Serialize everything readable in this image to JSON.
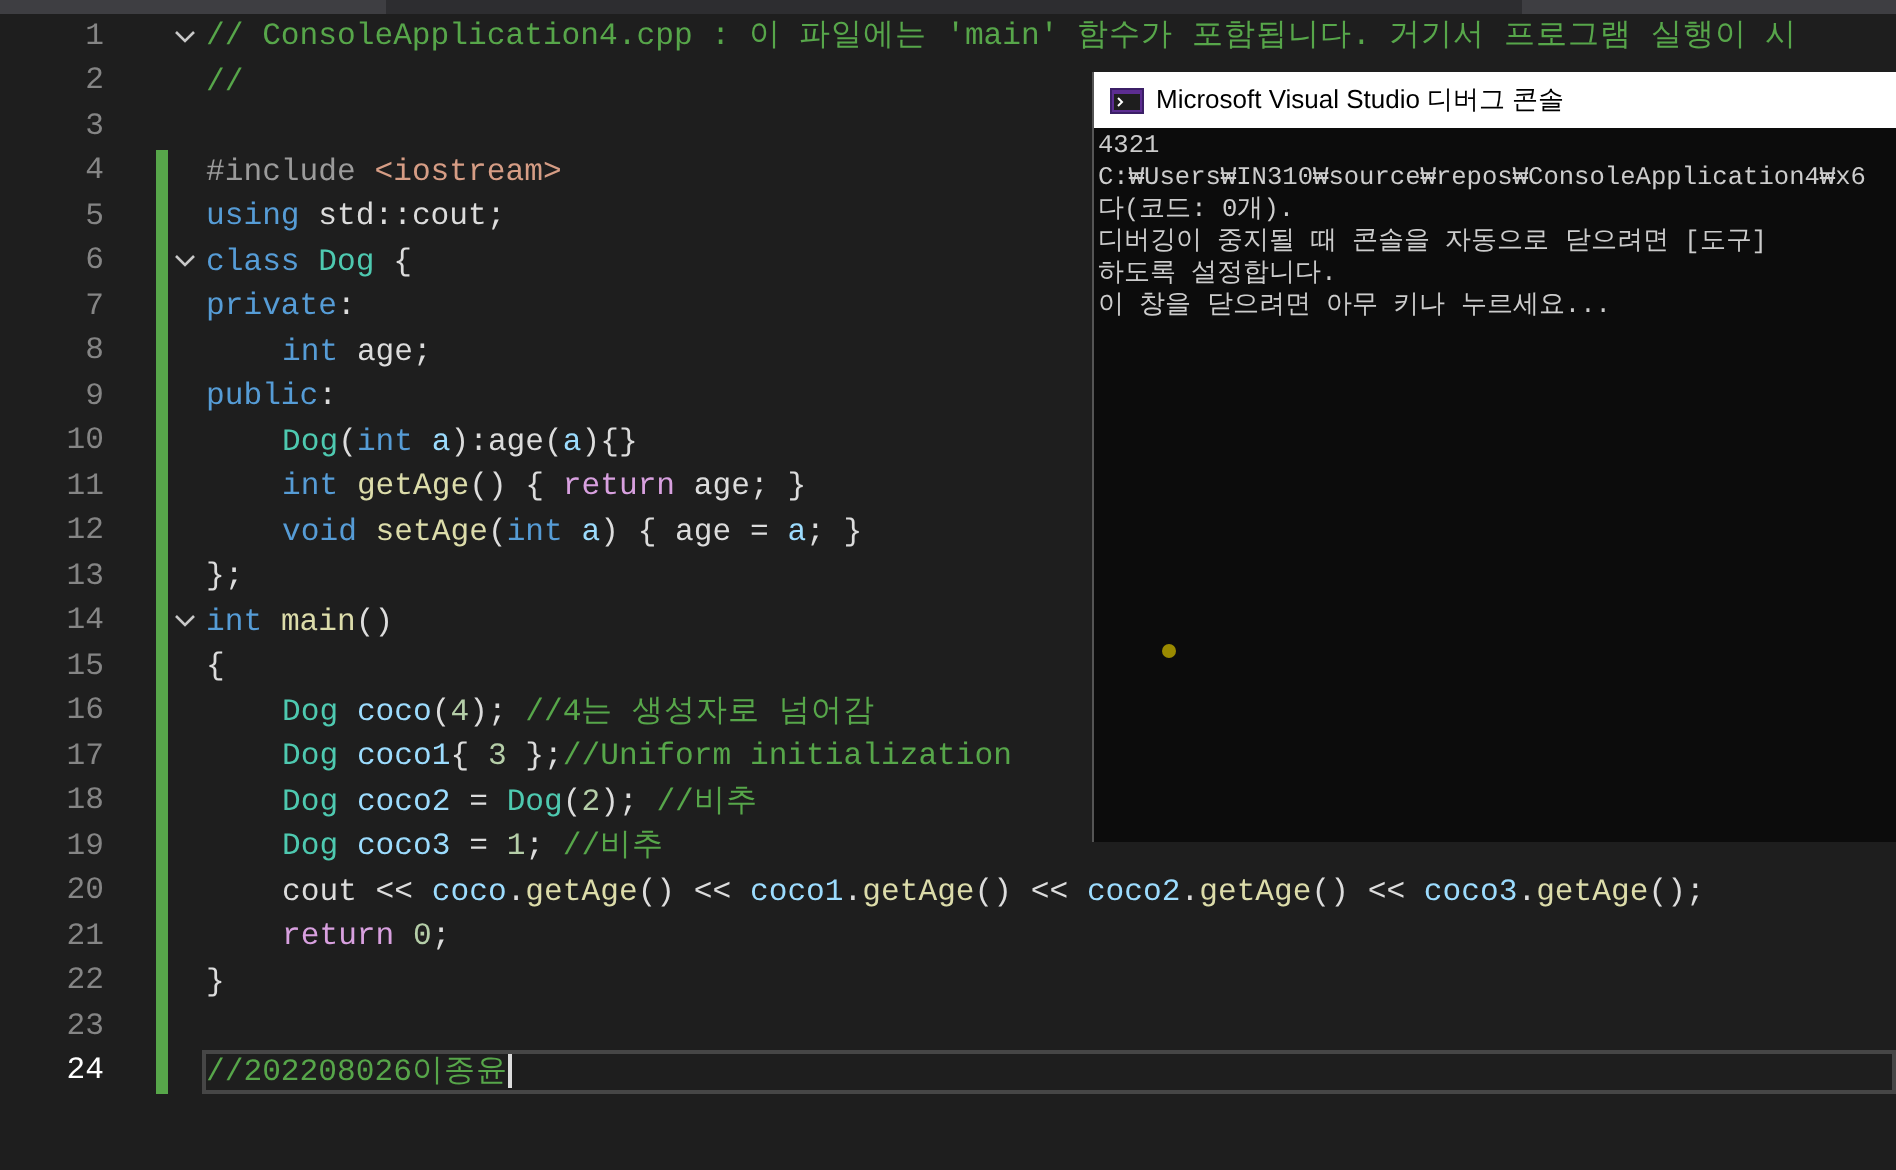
{
  "editor": {
    "lines": [
      {
        "number": "1",
        "fold": true,
        "changed": false,
        "current": false,
        "indented": false,
        "tokens": [
          {
            "kind": "cmt",
            "text": "// ConsoleApplication4.cpp : 이 파일에는 'main' 함수가 포함됩니다. 거기서 프로그램 실행이 시"
          }
        ]
      },
      {
        "number": "2",
        "fold": false,
        "changed": false,
        "current": false,
        "indented": false,
        "tokens": [
          {
            "kind": "cmt",
            "text": "//"
          }
        ]
      },
      {
        "number": "3",
        "fold": false,
        "changed": false,
        "current": false,
        "indented": false
      },
      {
        "number": "4",
        "fold": false,
        "changed": true,
        "current": false,
        "indented": false,
        "tokens": [
          {
            "kind": "pre",
            "text": "#include "
          },
          {
            "kind": "str",
            "text": "<iostream>"
          }
        ]
      },
      {
        "number": "5",
        "fold": false,
        "changed": true,
        "current": false,
        "indented": false,
        "tokens": [
          {
            "kind": "kw",
            "text": "using "
          },
          {
            "kind": "plain",
            "text": "std::cout;"
          }
        ]
      },
      {
        "number": "6",
        "fold": true,
        "changed": true,
        "current": false,
        "indented": false,
        "tokens": [
          {
            "kind": "kw",
            "text": "class "
          },
          {
            "kind": "type",
            "text": "Dog"
          },
          {
            "kind": "plain",
            "text": " {"
          }
        ]
      },
      {
        "number": "7",
        "fold": false,
        "changed": true,
        "current": false,
        "indented": false,
        "tokens": [
          {
            "kind": "kw",
            "text": "private"
          },
          {
            "kind": "plain",
            "text": ":"
          }
        ]
      },
      {
        "number": "8",
        "fold": false,
        "changed": true,
        "current": false,
        "indented": true,
        "tokens": [
          {
            "kind": "kw",
            "text": "int "
          },
          {
            "kind": "plain",
            "text": "age;"
          }
        ]
      },
      {
        "number": "9",
        "fold": false,
        "changed": true,
        "current": false,
        "indented": false,
        "tokens": [
          {
            "kind": "kw",
            "text": "public"
          },
          {
            "kind": "plain",
            "text": ":"
          }
        ]
      },
      {
        "number": "10",
        "fold": false,
        "changed": true,
        "current": false,
        "indented": true,
        "tokens": [
          {
            "kind": "type",
            "text": "Dog"
          },
          {
            "kind": "plain",
            "text": "("
          },
          {
            "kind": "kw",
            "text": "int "
          },
          {
            "kind": "var",
            "text": "a"
          },
          {
            "kind": "plain",
            "text": "):age("
          },
          {
            "kind": "var",
            "text": "a"
          },
          {
            "kind": "plain",
            "text": "){}"
          }
        ]
      },
      {
        "number": "11",
        "fold": false,
        "changed": true,
        "current": false,
        "indented": true,
        "tokens": [
          {
            "kind": "kw",
            "text": "int "
          },
          {
            "kind": "fn",
            "text": "getAge"
          },
          {
            "kind": "plain",
            "text": "() { "
          },
          {
            "kind": "ctl",
            "text": "return"
          },
          {
            "kind": "plain",
            "text": " age; }"
          }
        ]
      },
      {
        "number": "12",
        "fold": false,
        "changed": true,
        "current": false,
        "indented": true,
        "tokens": [
          {
            "kind": "kw",
            "text": "void "
          },
          {
            "kind": "fn",
            "text": "setAge"
          },
          {
            "kind": "plain",
            "text": "("
          },
          {
            "kind": "kw",
            "text": "int "
          },
          {
            "kind": "var",
            "text": "a"
          },
          {
            "kind": "plain",
            "text": ") { age = "
          },
          {
            "kind": "var",
            "text": "a"
          },
          {
            "kind": "plain",
            "text": "; }"
          }
        ]
      },
      {
        "number": "13",
        "fold": false,
        "changed": true,
        "current": false,
        "indented": false,
        "tokens": [
          {
            "kind": "plain",
            "text": "};"
          }
        ]
      },
      {
        "number": "14",
        "fold": true,
        "changed": true,
        "current": false,
        "indented": false,
        "tokens": [
          {
            "kind": "kw",
            "text": "int "
          },
          {
            "kind": "fn",
            "text": "main"
          },
          {
            "kind": "plain",
            "text": "()"
          }
        ]
      },
      {
        "number": "15",
        "fold": false,
        "changed": true,
        "current": false,
        "indented": false,
        "tokens": [
          {
            "kind": "plain",
            "text": "{"
          }
        ]
      },
      {
        "number": "16",
        "fold": false,
        "changed": true,
        "current": false,
        "indented": true,
        "tokens": [
          {
            "kind": "type",
            "text": "Dog "
          },
          {
            "kind": "var",
            "text": "coco"
          },
          {
            "kind": "plain",
            "text": "("
          },
          {
            "kind": "num",
            "text": "4"
          },
          {
            "kind": "plain",
            "text": "); "
          },
          {
            "kind": "cmt",
            "text": "//4는 생성자로 넘어감"
          }
        ]
      },
      {
        "number": "17",
        "fold": false,
        "changed": true,
        "current": false,
        "indented": true,
        "tokens": [
          {
            "kind": "type",
            "text": "Dog "
          },
          {
            "kind": "var",
            "text": "coco1"
          },
          {
            "kind": "plain",
            "text": "{ "
          },
          {
            "kind": "num",
            "text": "3"
          },
          {
            "kind": "plain",
            "text": " };"
          },
          {
            "kind": "cmt",
            "text": "//Uniform initialization"
          }
        ]
      },
      {
        "number": "18",
        "fold": false,
        "changed": true,
        "current": false,
        "indented": true,
        "tokens": [
          {
            "kind": "type",
            "text": "Dog "
          },
          {
            "kind": "var",
            "text": "coco2"
          },
          {
            "kind": "plain",
            "text": " = "
          },
          {
            "kind": "type",
            "text": "Dog"
          },
          {
            "kind": "plain",
            "text": "("
          },
          {
            "kind": "num",
            "text": "2"
          },
          {
            "kind": "plain",
            "text": "); "
          },
          {
            "kind": "cmt",
            "text": "//비추"
          }
        ]
      },
      {
        "number": "19",
        "fold": false,
        "changed": true,
        "current": false,
        "indented": true,
        "tokens": [
          {
            "kind": "type",
            "text": "Dog "
          },
          {
            "kind": "var",
            "text": "coco3"
          },
          {
            "kind": "plain",
            "text": " = "
          },
          {
            "kind": "num",
            "text": "1"
          },
          {
            "kind": "plain",
            "text": "; "
          },
          {
            "kind": "cmt",
            "text": "//비추"
          }
        ]
      },
      {
        "number": "20",
        "fold": false,
        "changed": true,
        "current": false,
        "indented": true,
        "tokens": [
          {
            "kind": "plain",
            "text": "cout << "
          },
          {
            "kind": "var",
            "text": "coco"
          },
          {
            "kind": "plain",
            "text": "."
          },
          {
            "kind": "fn",
            "text": "getAge"
          },
          {
            "kind": "plain",
            "text": "() << "
          },
          {
            "kind": "var",
            "text": "coco1"
          },
          {
            "kind": "plain",
            "text": "."
          },
          {
            "kind": "fn",
            "text": "getAge"
          },
          {
            "kind": "plain",
            "text": "() << "
          },
          {
            "kind": "var",
            "text": "coco2"
          },
          {
            "kind": "plain",
            "text": "."
          },
          {
            "kind": "fn",
            "text": "getAge"
          },
          {
            "kind": "plain",
            "text": "() << "
          },
          {
            "kind": "var",
            "text": "coco3"
          },
          {
            "kind": "plain",
            "text": "."
          },
          {
            "kind": "fn",
            "text": "getAge"
          },
          {
            "kind": "plain",
            "text": "();"
          }
        ]
      },
      {
        "number": "21",
        "fold": false,
        "changed": true,
        "current": false,
        "indented": true,
        "tokens": [
          {
            "kind": "ctl",
            "text": "return "
          },
          {
            "kind": "num",
            "text": "0"
          },
          {
            "kind": "plain",
            "text": ";"
          }
        ]
      },
      {
        "number": "22",
        "fold": false,
        "changed": true,
        "current": false,
        "indented": false,
        "tokens": [
          {
            "kind": "plain",
            "text": "}"
          }
        ]
      },
      {
        "number": "23",
        "fold": false,
        "changed": true,
        "current": false,
        "indented": false
      },
      {
        "number": "24",
        "fold": false,
        "changed": true,
        "current": true,
        "indented": false,
        "tokens": [
          {
            "kind": "cmt",
            "text": "//202208026이종윤"
          }
        ]
      }
    ]
  },
  "console": {
    "title": "Microsoft Visual Studio 디버그 콘솔",
    "lines": [
      "4321",
      "C:₩Users₩IN310₩source₩repos₩ConsoleApplication4₩x6",
      "다(코드: 0개).",
      "디버깅이 중지될 때 콘솔을 자동으로 닫으려면 [도구]",
      "하도록 설정합니다.",
      "이 창을 닫으려면 아무 키나 누르세요..."
    ]
  }
}
